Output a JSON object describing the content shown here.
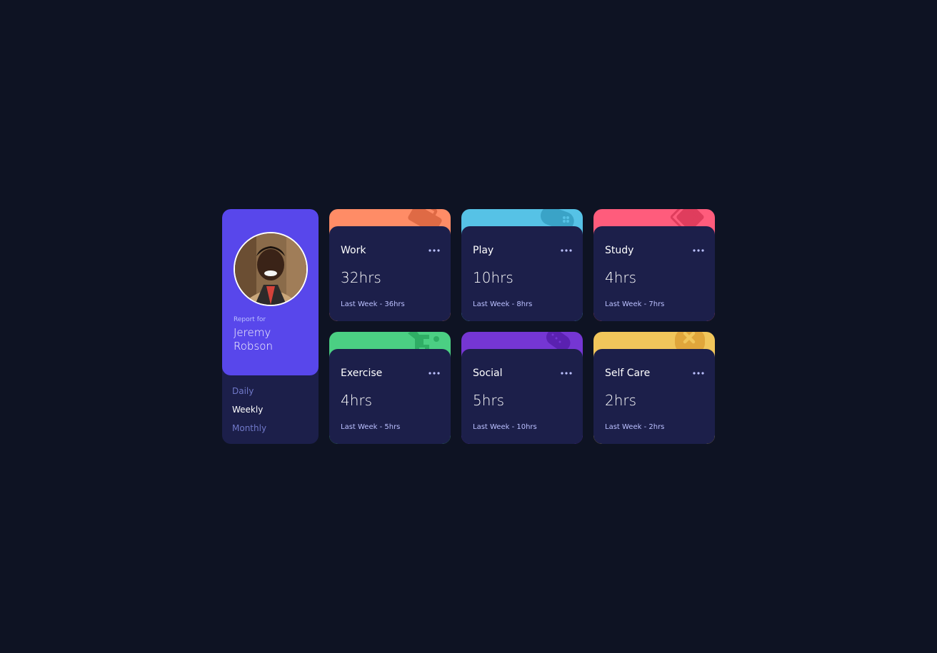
{
  "profile": {
    "report_label": "Report for",
    "name": "Jeremy Robson"
  },
  "timeframes": [
    {
      "label": "Daily",
      "active": false
    },
    {
      "label": "Weekly",
      "active": true
    },
    {
      "label": "Monthly",
      "active": false
    }
  ],
  "activities": [
    {
      "title": "Work",
      "current": "32hrs",
      "previous": "Last Week - 36hrs",
      "color": "#ff8c66",
      "icon": "briefcase-icon"
    },
    {
      "title": "Play",
      "current": "10hrs",
      "previous": "Last Week - 8hrs",
      "color": "#56c2e6",
      "icon": "game-controller-icon"
    },
    {
      "title": "Study",
      "current": "4hrs",
      "previous": "Last Week - 7hrs",
      "color": "#ff5c7c",
      "icon": "books-icon"
    },
    {
      "title": "Exercise",
      "current": "4hrs",
      "previous": "Last Week - 5hrs",
      "color": "#4bcf83",
      "icon": "running-person-icon"
    },
    {
      "title": "Social",
      "current": "5hrs",
      "previous": "Last Week - 10hrs",
      "color": "#7536d3",
      "icon": "social-bubble-icon"
    },
    {
      "title": "Self Care",
      "current": "2hrs",
      "previous": "Last Week - 2hrs",
      "color": "#f1c65b",
      "icon": "self-care-icon"
    }
  ],
  "theme": {
    "background": "#0e1323",
    "card": "#1c1f4a",
    "accent": "#5847eb"
  }
}
